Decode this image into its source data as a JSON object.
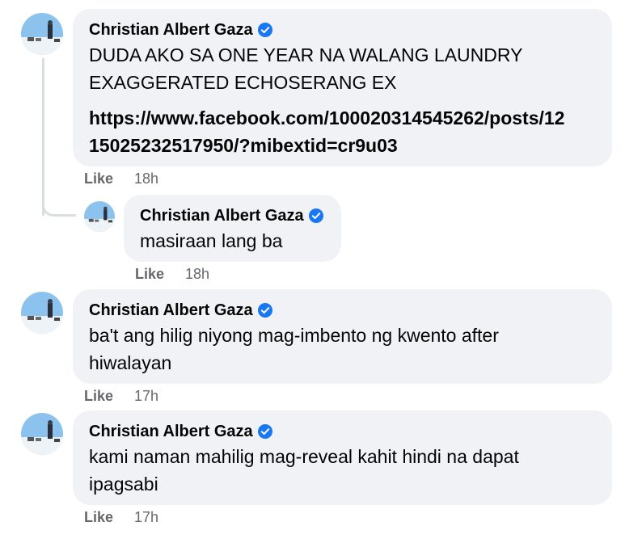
{
  "colors": {
    "bubble": "#f0f2f5",
    "meta": "#65676b",
    "verified": "#1877f2",
    "thread_line": "#dadde1"
  },
  "icons": {
    "verified": "verified-badge-icon",
    "avatar": "profile-photo-snow-dogs"
  },
  "comments": [
    {
      "author": "Christian Albert Gaza",
      "text_lines": [
        "DUDA AKO SA ONE YEAR NA WALANG LAUNDRY",
        "EXAGGERATED ECHOSERANG EX"
      ],
      "link_lines": [
        "https://www.facebook.com/100020314545262/posts/12",
        "15025232517950/?mibextid=cr9u03"
      ],
      "like": "Like",
      "time": "18h"
    },
    {
      "author": "Christian Albert Gaza",
      "text_lines": [
        "masiraan lang ba"
      ],
      "like": "Like",
      "time": "18h"
    },
    {
      "author": "Christian Albert Gaza",
      "text_lines": [
        "ba't ang hilig niyong mag-imbento ng kwento after",
        "hiwalayan"
      ],
      "like": "Like",
      "time": "17h"
    },
    {
      "author": "Christian Albert Gaza",
      "text_lines": [
        "kami naman mahilig mag-reveal kahit hindi na dapat",
        "ipagsabi"
      ],
      "like": "Like",
      "time": "17h"
    }
  ]
}
